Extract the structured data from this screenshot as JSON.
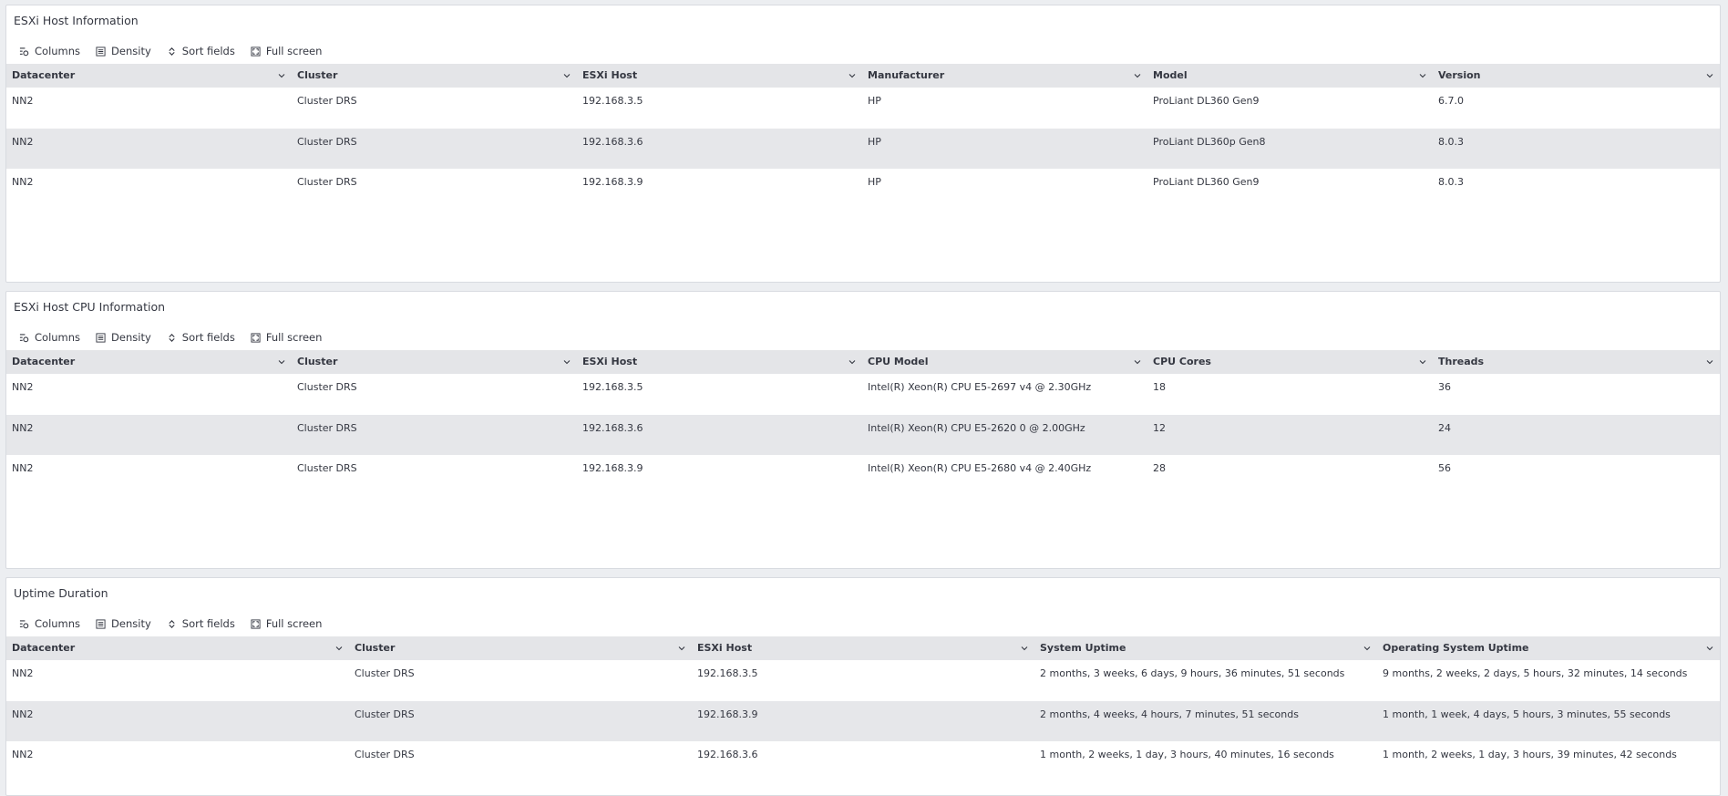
{
  "toolbar": {
    "columns_label": "Columns",
    "density_label": "Density",
    "sort_label": "Sort fields",
    "fullscreen_label": "Full screen"
  },
  "host_panel": {
    "title": "ESXi Host Information",
    "columns": [
      "Datacenter",
      "Cluster",
      "ESXi Host",
      "Manufacturer",
      "Model",
      "Version"
    ],
    "rows": [
      [
        "NN2",
        "Cluster DRS",
        "192.168.3.5",
        "HP",
        "ProLiant DL360 Gen9",
        "6.7.0"
      ],
      [
        "NN2",
        "Cluster DRS",
        "192.168.3.6",
        "HP",
        "ProLiant DL360p Gen8",
        "8.0.3"
      ],
      [
        "NN2",
        "Cluster DRS",
        "192.168.3.9",
        "HP",
        "ProLiant DL360 Gen9",
        "8.0.3"
      ]
    ]
  },
  "cpu_panel": {
    "title": "ESXi Host CPU Information",
    "columns": [
      "Datacenter",
      "Cluster",
      "ESXi Host",
      "CPU Model",
      "CPU Cores",
      "Threads"
    ],
    "rows": [
      [
        "NN2",
        "Cluster DRS",
        "192.168.3.5",
        "Intel(R) Xeon(R) CPU E5-2697 v4 @ 2.30GHz",
        "18",
        "36"
      ],
      [
        "NN2",
        "Cluster DRS",
        "192.168.3.6",
        "Intel(R) Xeon(R) CPU E5-2620 0 @ 2.00GHz",
        "12",
        "24"
      ],
      [
        "NN2",
        "Cluster DRS",
        "192.168.3.9",
        "Intel(R) Xeon(R) CPU E5-2680 v4 @ 2.40GHz",
        "28",
        "56"
      ]
    ]
  },
  "uptime_panel": {
    "title": "Uptime Duration",
    "columns": [
      "Datacenter",
      "Cluster",
      "ESXi Host",
      "System Uptime",
      "Operating System Uptime"
    ],
    "rows": [
      [
        "NN2",
        "Cluster DRS",
        "192.168.3.5",
        "2 months, 3 weeks, 6 days, 9 hours, 36 minutes, 51 seconds",
        "9 months, 2 weeks, 2 days, 5 hours, 32 minutes, 14 seconds"
      ],
      [
        "NN2",
        "Cluster DRS",
        "192.168.3.9",
        "2 months, 4 weeks, 4 hours, 7 minutes, 51 seconds",
        "1 month, 1 week, 4 days, 5 hours, 3 minutes, 55 seconds"
      ],
      [
        "NN2",
        "Cluster DRS",
        "192.168.3.6",
        "1 month, 2 weeks, 1 day, 3 hours, 40 minutes, 16 seconds",
        "1 month, 2 weeks, 1 day, 3 hours, 39 minutes, 42 seconds"
      ]
    ]
  }
}
